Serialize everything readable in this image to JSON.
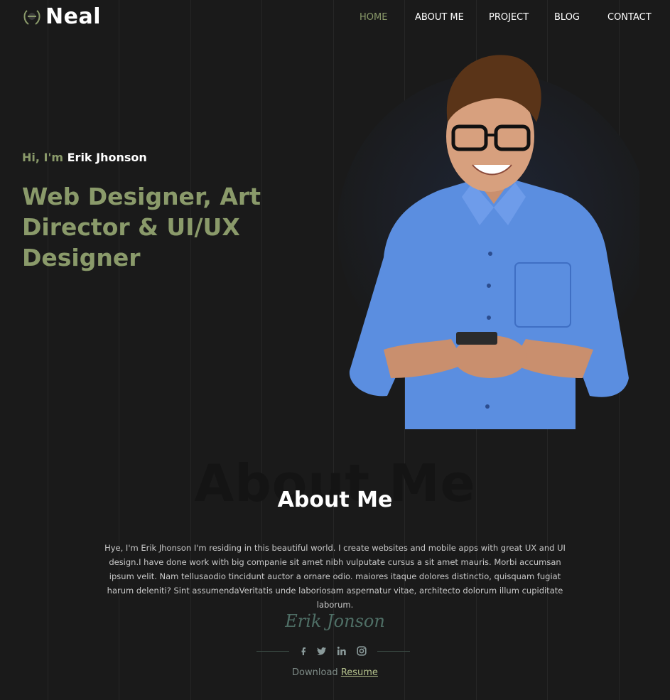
{
  "brand": {
    "name": "Neal"
  },
  "nav": {
    "items": [
      {
        "label": "HOME",
        "active": true
      },
      {
        "label": "ABOUT ME"
      },
      {
        "label": "PROJECT"
      },
      {
        "label": "BLOG"
      },
      {
        "label": "CONTACT"
      }
    ]
  },
  "hero": {
    "greeting": "Hi, I'm",
    "name": "Erik Jhonson",
    "headline": "Web Designer, Art Director & UI/UX Designer"
  },
  "about": {
    "bg_title": "About Me",
    "title": "About Me",
    "text": "Hye, I'm Erik Jhonson I'm residing in this beautiful world. I create websites and mobile apps with great UX and UI design.I have done work with big companie sit amet nibh vulputate cursus a sit amet mauris. Morbi accumsan ipsum velit. Nam tellusaodio tincidunt auctor a ornare odio. maiores itaque dolores distinctio, quisquam fugiat harum deleniti? Sint assumendaVeritatis unde laboriosam aspernatur vitae, architecto dolorum illum cupiditate laborum.",
    "signature": "Erik Jonson",
    "download_prefix": "Download",
    "download_link": "Resume"
  },
  "social": [
    "facebook-icon",
    "twitter-icon",
    "linkedin-icon",
    "instagram-icon"
  ],
  "colors": {
    "accent": "#8a9a6a",
    "background": "#1a1a1a",
    "shirt": "#5b8ee0",
    "signature": "#4f6f66"
  }
}
